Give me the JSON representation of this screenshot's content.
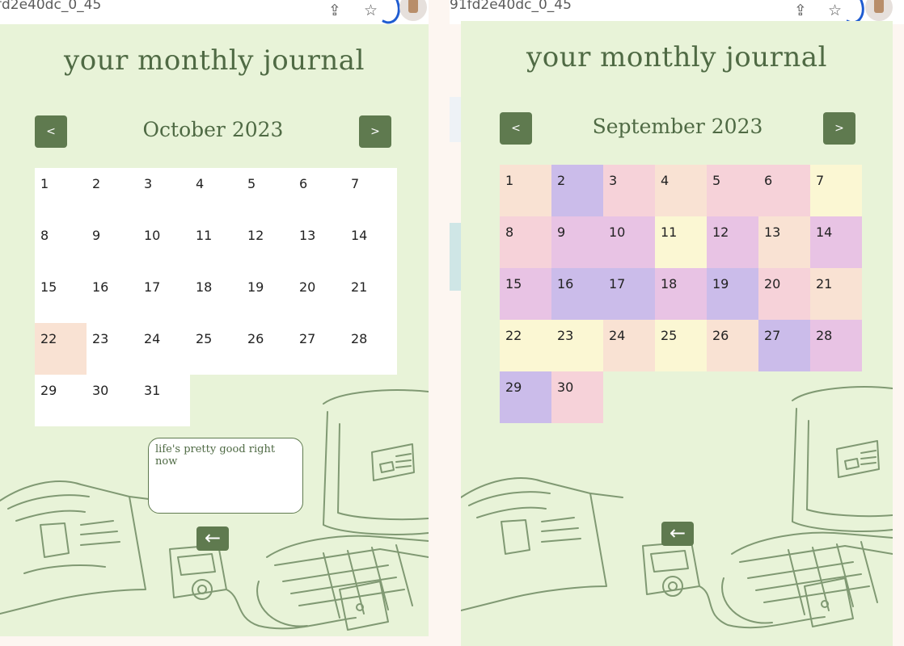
{
  "left": {
    "chrome": {
      "url": "fd2e40dc_0_45"
    },
    "app": {
      "title": "your monthly journal",
      "prev_label": "<",
      "next_label": ">",
      "month": "October 2023",
      "note_text": "life's pretty good right now",
      "back_label": "←"
    },
    "days": [
      {
        "day": "1",
        "color": "#ffffff"
      },
      {
        "day": "2",
        "color": "#ffffff"
      },
      {
        "day": "3",
        "color": "#ffffff"
      },
      {
        "day": "4",
        "color": "#ffffff"
      },
      {
        "day": "5",
        "color": "#ffffff"
      },
      {
        "day": "6",
        "color": "#ffffff"
      },
      {
        "day": "7",
        "color": "#ffffff"
      },
      {
        "day": "8",
        "color": "#ffffff"
      },
      {
        "day": "9",
        "color": "#ffffff"
      },
      {
        "day": "10",
        "color": "#ffffff"
      },
      {
        "day": "11",
        "color": "#ffffff"
      },
      {
        "day": "12",
        "color": "#ffffff"
      },
      {
        "day": "13",
        "color": "#ffffff"
      },
      {
        "day": "14",
        "color": "#ffffff"
      },
      {
        "day": "15",
        "color": "#ffffff"
      },
      {
        "day": "16",
        "color": "#ffffff"
      },
      {
        "day": "17",
        "color": "#ffffff"
      },
      {
        "day": "18",
        "color": "#ffffff"
      },
      {
        "day": "19",
        "color": "#ffffff"
      },
      {
        "day": "20",
        "color": "#ffffff"
      },
      {
        "day": "21",
        "color": "#ffffff"
      },
      {
        "day": "22",
        "color": "#f9e2d3"
      },
      {
        "day": "23",
        "color": "#ffffff"
      },
      {
        "day": "24",
        "color": "#ffffff"
      },
      {
        "day": "25",
        "color": "#ffffff"
      },
      {
        "day": "26",
        "color": "#ffffff"
      },
      {
        "day": "27",
        "color": "#ffffff"
      },
      {
        "day": "28",
        "color": "#ffffff"
      },
      {
        "day": "29",
        "color": "#ffffff"
      },
      {
        "day": "30",
        "color": "#ffffff"
      },
      {
        "day": "31",
        "color": "#ffffff"
      }
    ]
  },
  "right": {
    "chrome": {
      "url": "91fd2e40dc_0_45"
    },
    "app": {
      "title": "your monthly journal",
      "prev_label": "<",
      "next_label": ">",
      "month": "September 2023",
      "back_label": "←"
    },
    "days": [
      {
        "day": "1",
        "color": "#f9e2d3"
      },
      {
        "day": "2",
        "color": "#cbbcea"
      },
      {
        "day": "3",
        "color": "#f6d2d9"
      },
      {
        "day": "4",
        "color": "#f9e2d3"
      },
      {
        "day": "5",
        "color": "#f6d2d9"
      },
      {
        "day": "6",
        "color": "#f6d2d9"
      },
      {
        "day": "7",
        "color": "#fbf7d3"
      },
      {
        "day": "8",
        "color": "#f6d2d9"
      },
      {
        "day": "9",
        "color": "#e8c3e4"
      },
      {
        "day": "10",
        "color": "#e8c3e4"
      },
      {
        "day": "11",
        "color": "#fbf7d3"
      },
      {
        "day": "12",
        "color": "#e8c3e4"
      },
      {
        "day": "13",
        "color": "#f9e2d3"
      },
      {
        "day": "14",
        "color": "#e8c3e4"
      },
      {
        "day": "15",
        "color": "#e8c3e4"
      },
      {
        "day": "16",
        "color": "#cbbcea"
      },
      {
        "day": "17",
        "color": "#cbbcea"
      },
      {
        "day": "18",
        "color": "#e8c3e4"
      },
      {
        "day": "19",
        "color": "#cbbcea"
      },
      {
        "day": "20",
        "color": "#f6d2d9"
      },
      {
        "day": "21",
        "color": "#f9e2d3"
      },
      {
        "day": "22",
        "color": "#fbf7d3"
      },
      {
        "day": "23",
        "color": "#fbf7d3"
      },
      {
        "day": "24",
        "color": "#f9e2d3"
      },
      {
        "day": "25",
        "color": "#fbf7d3"
      },
      {
        "day": "26",
        "color": "#f9e2d3"
      },
      {
        "day": "27",
        "color": "#cbbcea"
      },
      {
        "day": "28",
        "color": "#e8c3e4"
      },
      {
        "day": "29",
        "color": "#cbbcea"
      },
      {
        "day": "30",
        "color": "#f6d2d9"
      }
    ]
  },
  "theme": {
    "accent": "#5f7a4f",
    "background": "#e8f3d8",
    "text": "#4f6a44"
  }
}
